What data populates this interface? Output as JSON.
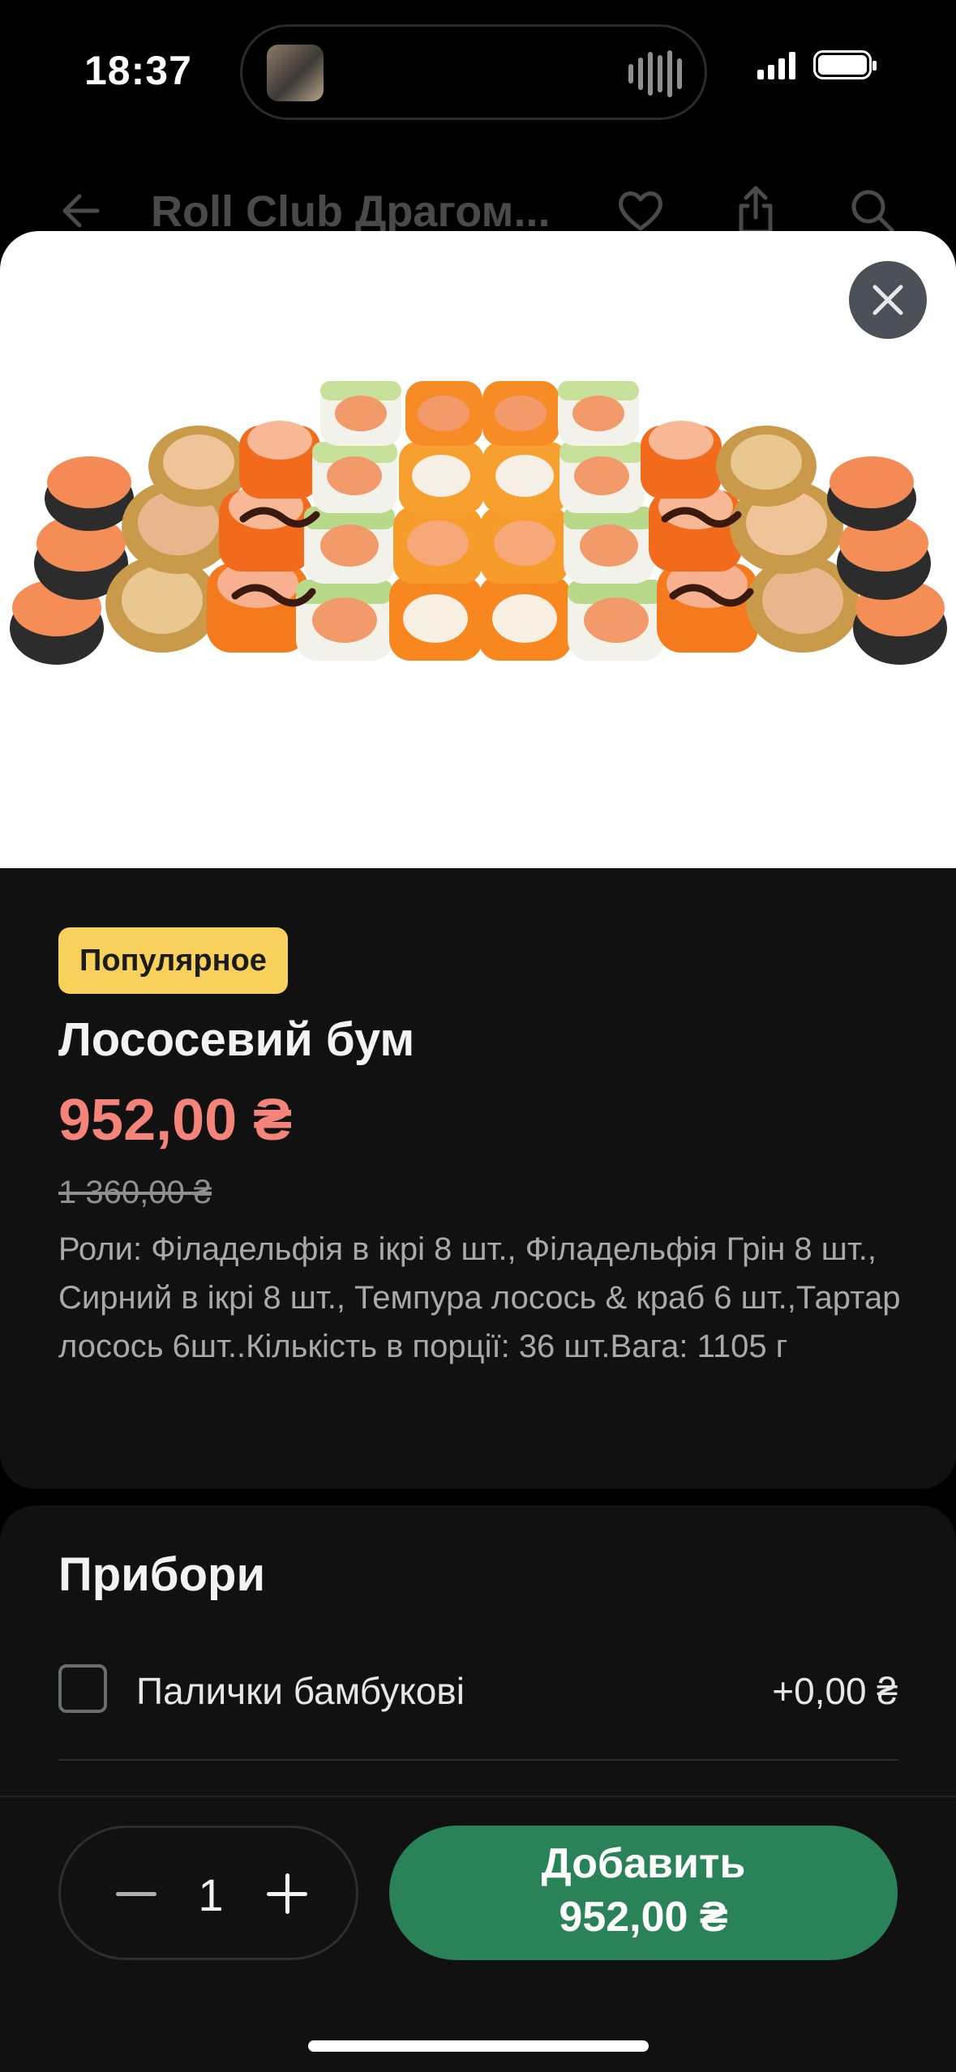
{
  "status_bar": {
    "time": "18:37"
  },
  "background_nav": {
    "back_icon": "arrow-left-icon",
    "title": "Roll Club Драгом...",
    "icons": [
      "heart-icon",
      "share-icon",
      "search-icon"
    ]
  },
  "product": {
    "image_alt": "sushi-set-photo",
    "badge": "Популярное",
    "title": "Лососевий бум",
    "price": "952,00 ₴",
    "old_price": "1 360,00 ₴",
    "description": "Роли: Філадельфія в ікрі 8 шт., Філадельфія Грін 8 шт., Сирний в ікрі 8 шт., Темпура лосось & краб 6 шт.,Тартар лосось 6шт..Кількість в порції: 36 шт.Вага: 1105 г"
  },
  "options": {
    "title": "Прибори",
    "items": [
      {
        "label": "Палички бамбукові",
        "price": "+0,00 ₴",
        "checked": false
      }
    ]
  },
  "cart": {
    "quantity": "1",
    "add_label": "Добавить",
    "add_price": "952,00 ₴"
  },
  "colors": {
    "accent_green": "#2a8358",
    "price_red": "#f4837a",
    "badge_yellow": "#f7d15b",
    "card_bg": "#111112"
  }
}
